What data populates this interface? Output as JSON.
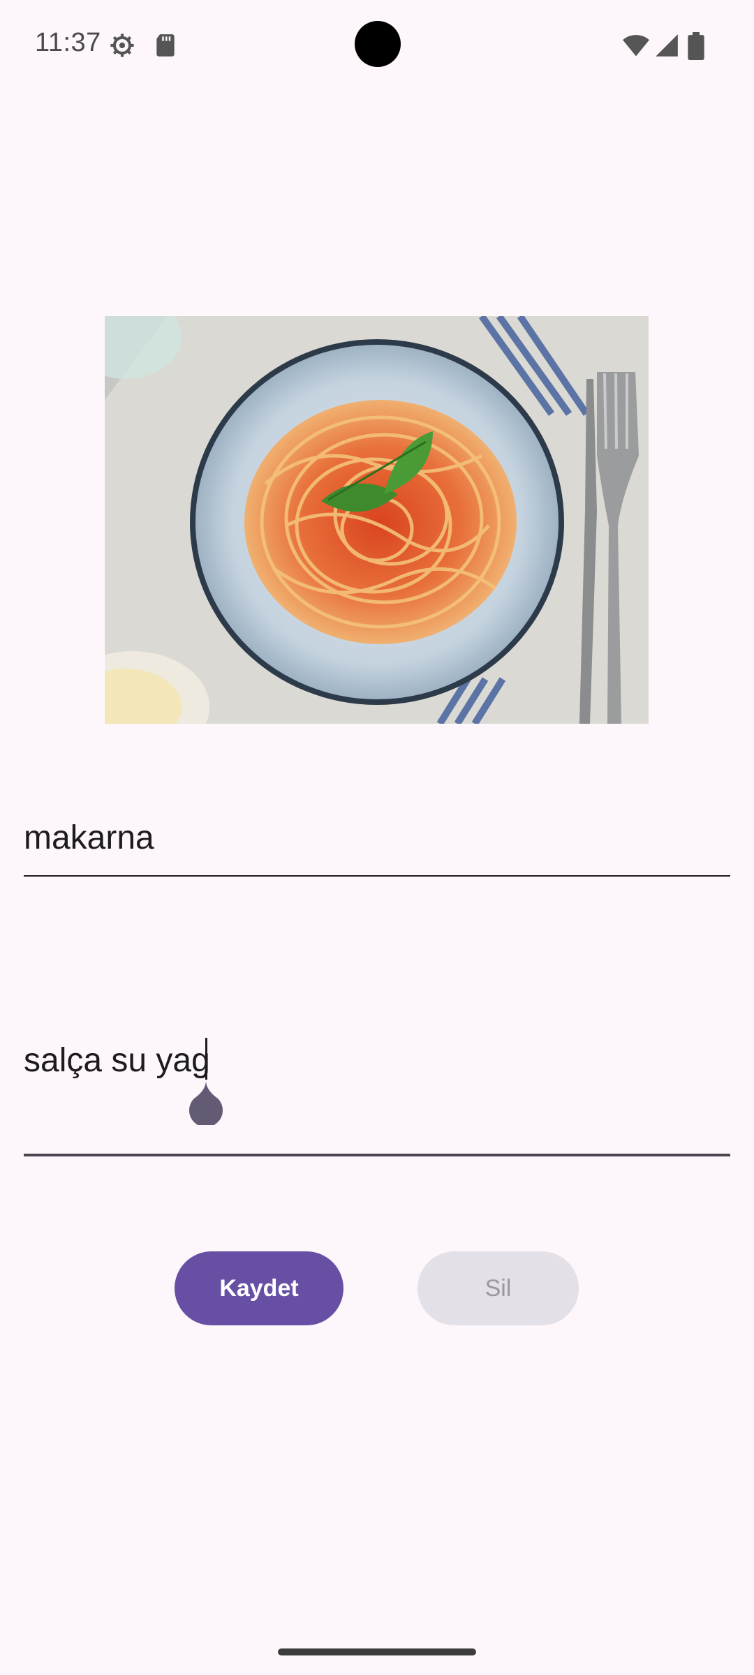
{
  "status_bar": {
    "time": "11:37",
    "icons": [
      "settings-icon",
      "sd-card-icon",
      "wifi-icon",
      "signal-icon",
      "battery-icon"
    ]
  },
  "image": {
    "subject": "spaghetti-with-tomato-sauce"
  },
  "form": {
    "name_value": "makarna",
    "ingredients_value": "salça su yag"
  },
  "buttons": {
    "save_label": "Kaydet",
    "delete_label": "Sil"
  },
  "colors": {
    "primary": "#6750a4",
    "background": "#fdf7fc",
    "disabled_bg": "#e4e0e7",
    "disabled_text": "#9a979e"
  }
}
